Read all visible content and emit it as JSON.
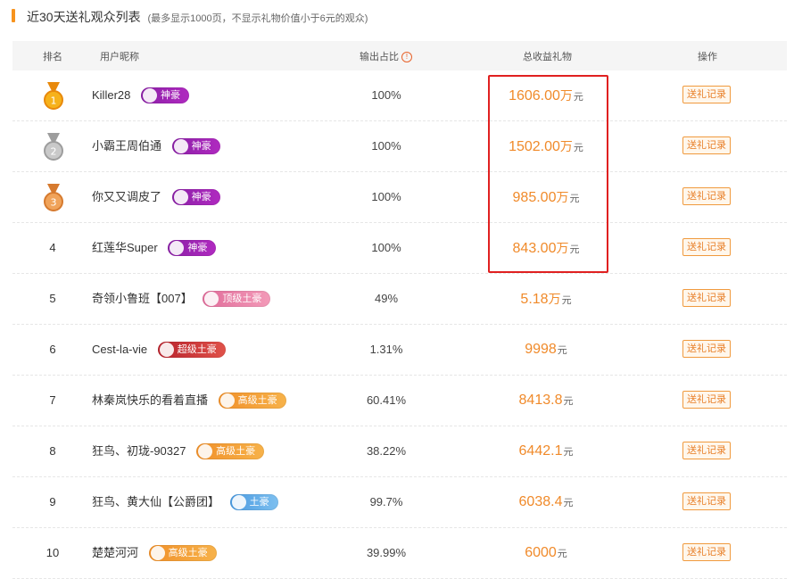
{
  "title": {
    "main": "近30天送礼观众列表",
    "note": "(最多显示1000页，不显示礼物价值小于6元的观众)"
  },
  "headers": {
    "rank": "排名",
    "nickname": "用户昵称",
    "ratio": "输出占比",
    "ratio_info_icon": "info-icon",
    "gift": "总收益礼物",
    "action": "操作"
  },
  "colors": {
    "accent": "#f7931e",
    "gift_value": "#f08a2a",
    "highlight_box": "#e02020"
  },
  "rows": [
    {
      "rank": "1",
      "medal": "gold",
      "name": "Killer28",
      "badge": "神豪",
      "badge_tier": "shenhao",
      "ratio": "100%",
      "value": "1606.00",
      "unit_wan": "万",
      "unit_yuan": "元",
      "action": "送礼记录"
    },
    {
      "rank": "2",
      "medal": "silver",
      "name": "小霸王周伯通",
      "badge": "神豪",
      "badge_tier": "shenhao",
      "ratio": "100%",
      "value": "1502.00",
      "unit_wan": "万",
      "unit_yuan": "元",
      "action": "送礼记录"
    },
    {
      "rank": "3",
      "medal": "bronze",
      "name": "你又又调皮了",
      "badge": "神豪",
      "badge_tier": "shenhao",
      "ratio": "100%",
      "value": "985.00",
      "unit_wan": "万",
      "unit_yuan": "元",
      "action": "送礼记录"
    },
    {
      "rank": "4",
      "medal": "",
      "name": "红莲华Super",
      "badge": "神豪",
      "badge_tier": "shenhao",
      "ratio": "100%",
      "value": "843.00",
      "unit_wan": "万",
      "unit_yuan": "元",
      "action": "送礼记录"
    },
    {
      "rank": "5",
      "medal": "",
      "name": "奇领小鲁班【007】",
      "badge": "顶级土豪",
      "badge_tier": "dingji",
      "ratio": "49%",
      "value": "5.18",
      "unit_wan": "万",
      "unit_yuan": "元",
      "action": "送礼记录"
    },
    {
      "rank": "6",
      "medal": "",
      "name": "Cest-la-vie",
      "badge": "超级土豪",
      "badge_tier": "chaoji",
      "ratio": "1.31%",
      "value": "9998",
      "unit_wan": "",
      "unit_yuan": "元",
      "action": "送礼记录"
    },
    {
      "rank": "7",
      "medal": "",
      "name": "林秦岚快乐的看着直播",
      "badge": "高级土豪",
      "badge_tier": "gaoji",
      "ratio": "60.41%",
      "value": "8413.8",
      "unit_wan": "",
      "unit_yuan": "元",
      "action": "送礼记录"
    },
    {
      "rank": "8",
      "medal": "",
      "name": "狂鸟、初珑-90327",
      "badge": "高级土豪",
      "badge_tier": "gaoji",
      "ratio": "38.22%",
      "value": "6442.1",
      "unit_wan": "",
      "unit_yuan": "元",
      "action": "送礼记录"
    },
    {
      "rank": "9",
      "medal": "",
      "name": "狂鸟、黄大仙【公爵团】",
      "badge": "土豪",
      "badge_tier": "tuhao",
      "ratio": "99.7%",
      "value": "6038.4",
      "unit_wan": "",
      "unit_yuan": "元",
      "action": "送礼记录"
    },
    {
      "rank": "10",
      "medal": "",
      "name": "楚楚河河",
      "badge": "高级土豪",
      "badge_tier": "gaoji",
      "ratio": "39.99%",
      "value": "6000",
      "unit_wan": "",
      "unit_yuan": "元",
      "action": "送礼记录"
    }
  ]
}
